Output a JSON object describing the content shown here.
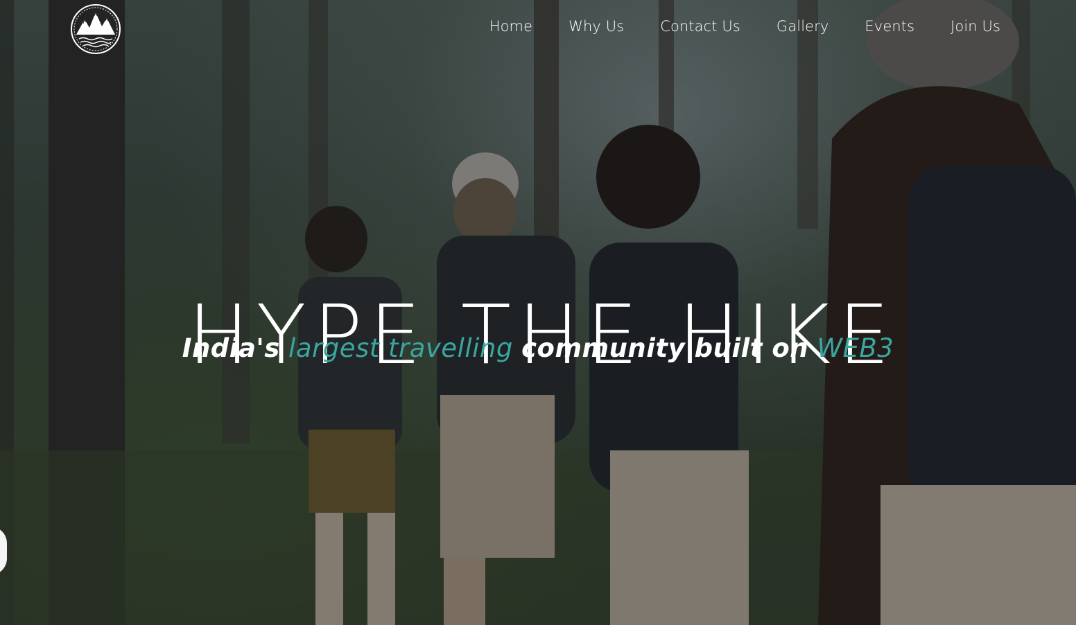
{
  "brand": {
    "logo_icon": "mountain-logo-icon"
  },
  "nav": {
    "items": [
      {
        "label": "Home"
      },
      {
        "label": "Why Us"
      },
      {
        "label": "Contact Us"
      },
      {
        "label": "Gallery"
      },
      {
        "label": "Events"
      },
      {
        "label": "Join Us"
      }
    ]
  },
  "hero": {
    "title": "HYPE THE HIKE",
    "subtitle": {
      "part1": "India's",
      "part2": "largest travelling",
      "part3": "community built on",
      "part4": "WEB3"
    }
  },
  "colors": {
    "accent": "#3ba6a0",
    "text": "#ffffff"
  }
}
